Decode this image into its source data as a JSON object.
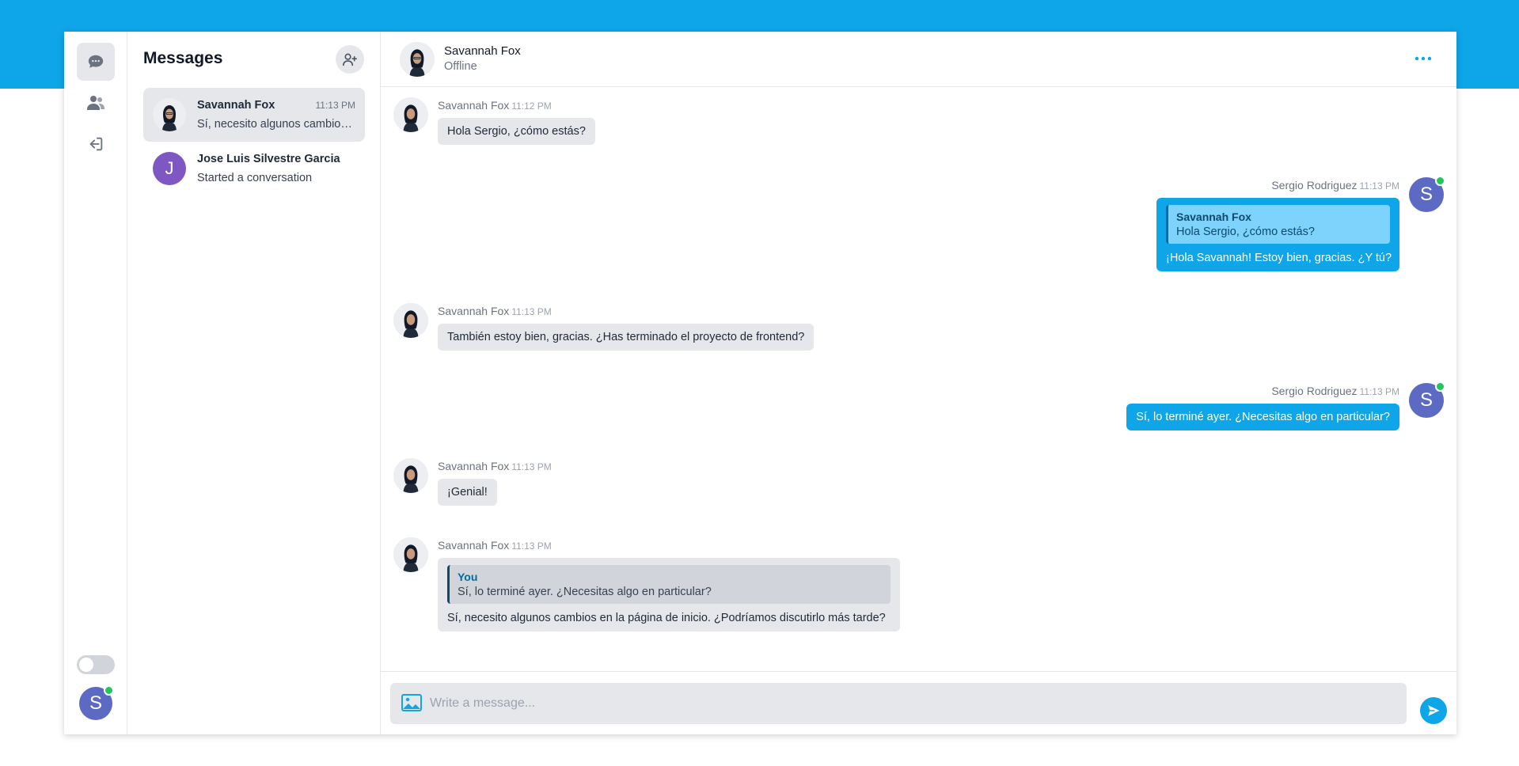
{
  "sidebar": {
    "nav": [
      {
        "name": "chat-bubble-icon"
      },
      {
        "name": "users-icon"
      },
      {
        "name": "logout-icon"
      }
    ],
    "user_initial": "S"
  },
  "conversations": {
    "title": "Messages",
    "items": [
      {
        "name": "Savannah Fox",
        "time": "11:13 PM",
        "preview": "Sí, necesito algunos cambios en la página de inicio. ¿Podríamos discutirlo más tarde?"
      },
      {
        "name": "Jose Luis Silvestre Garcia",
        "initial": "J",
        "preview": "Started a conversation"
      }
    ]
  },
  "chat": {
    "contact_name": "Savannah Fox",
    "contact_status": "Offline",
    "more_label": "···",
    "messages": [
      {
        "author": "Savannah Fox",
        "time": "11:12 PM",
        "text": "Hola Sergio, ¿cómo estás?"
      },
      {
        "author": "Sergio Rodriguez",
        "time": "11:13 PM",
        "initial": "S",
        "quote_author": "Savannah Fox",
        "quote_text": "Hola Sergio, ¿cómo estás?",
        "text": "¡Hola Savannah! Estoy bien, gracias. ¿Y tú?"
      },
      {
        "author": "Savannah Fox",
        "time": "11:13 PM",
        "text": "También estoy bien, gracias. ¿Has terminado el proyecto de frontend?"
      },
      {
        "author": "Sergio Rodriguez",
        "time": "11:13 PM",
        "initial": "S",
        "text": "Sí, lo terminé ayer. ¿Necesitas algo en particular?"
      },
      {
        "author": "Savannah Fox",
        "time": "11:13 PM",
        "text": "¡Genial!"
      },
      {
        "author": "Savannah Fox",
        "time": "11:13 PM",
        "quote_author": "You",
        "quote_text": "Sí, lo terminé ayer. ¿Necesitas algo en particular?",
        "text": "Sí, necesito algunos cambios en la página de inicio. ¿Podríamos discutirlo más tarde?"
      }
    ]
  },
  "composer": {
    "placeholder": "Write a message..."
  },
  "colors": {
    "accent": "#0ea5e9",
    "online": "#22c55e",
    "avatar_s": "#5c6ac4",
    "avatar_j": "#7e57c2"
  }
}
